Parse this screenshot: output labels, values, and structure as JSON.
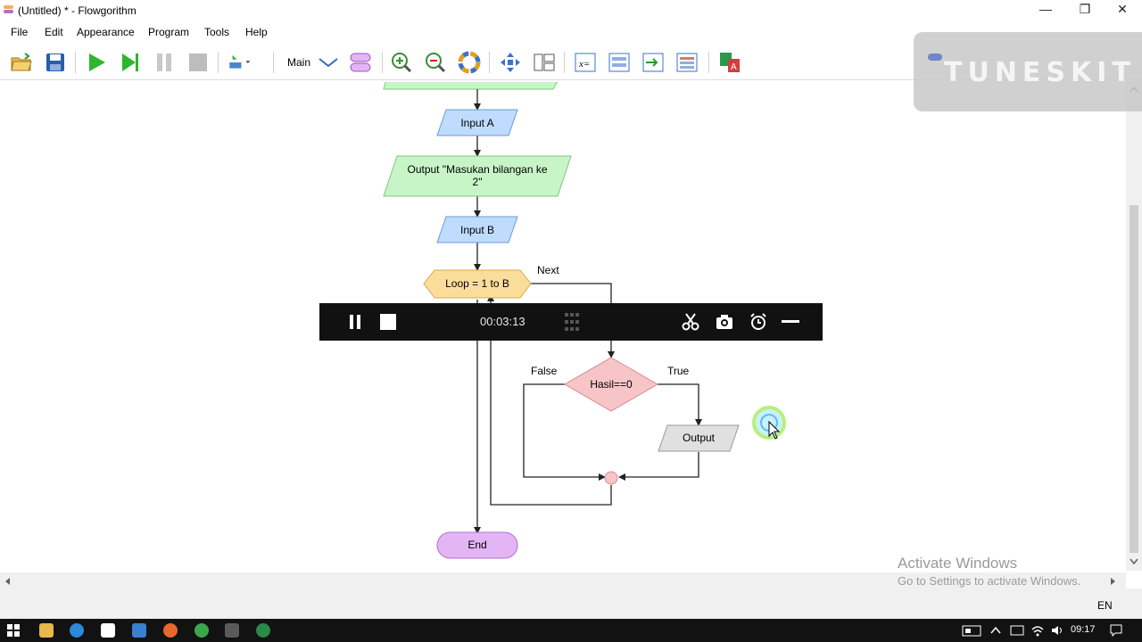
{
  "window": {
    "title": "(Untitled) * - Flowgorithm"
  },
  "menu": [
    "File",
    "Edit",
    "Appearance",
    "Program",
    "Tools",
    "Help"
  ],
  "toolbar": {
    "function_select": "Main"
  },
  "flowchart": {
    "input_a": "Input A",
    "output_masukan_line1": "Output \"Masukan bilangan ke",
    "output_masukan_line2": "2\"",
    "input_b": "Input B",
    "loop": "Loop = 1 to B",
    "loop_next": "Next",
    "decision": "Hasil==0",
    "decision_false": "False",
    "decision_true": "True",
    "output_node": "Output",
    "end": "End"
  },
  "recorder": {
    "time": "00:03:13"
  },
  "watermark": {
    "text": "TUNESKIT"
  },
  "activation": {
    "line1": "Activate Windows",
    "line2": "Go to Settings to activate Windows."
  },
  "statusbar": {
    "language": "EN"
  },
  "taskbar": {
    "time": "09:17"
  },
  "colors": {
    "io_fill": "#bfdcff",
    "output_fill": "#c8f5c8",
    "loop_fill": "#fbdd9b",
    "decision_fill": "#f7c4c8",
    "end_fill": "#e4b5f5",
    "output_gray": "#e0e0e0"
  }
}
